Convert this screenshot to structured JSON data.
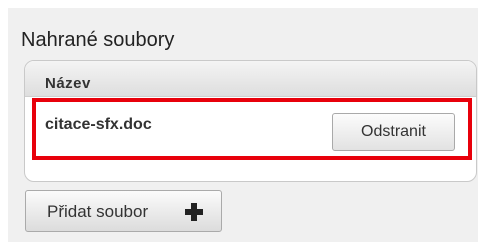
{
  "section": {
    "title": "Nahrané soubory"
  },
  "table": {
    "column_header": "Název",
    "rows": [
      {
        "file_name": "citace-sfx.doc",
        "remove_label": "Odstranit"
      }
    ]
  },
  "actions": {
    "add_file_label": "Přidat soubor",
    "add_icon": "plus-icon"
  },
  "colors": {
    "highlight_border": "#e8000b",
    "panel_background": "#f0f0f0"
  }
}
